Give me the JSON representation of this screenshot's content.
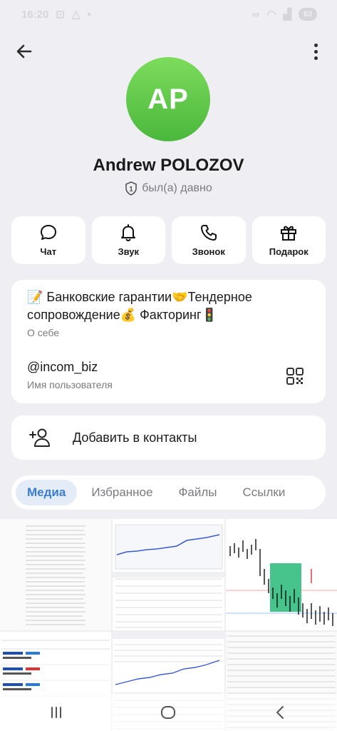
{
  "statusbar": {
    "time": "16:20",
    "battery": "83"
  },
  "profile": {
    "avatar_initials": "AP",
    "name": "Andrew POLOZOV",
    "last_seen": "был(а) давно",
    "avatar_color": "#5cc94a"
  },
  "actions": [
    {
      "label": "Чат",
      "icon": "chat-bubble-icon"
    },
    {
      "label": "Звук",
      "icon": "bell-icon"
    },
    {
      "label": "Звонок",
      "icon": "phone-icon"
    },
    {
      "label": "Подарок",
      "icon": "gift-icon"
    }
  ],
  "info": {
    "bio": "📝 Банковские гарантии🤝Тендерное сопровождение💰 Факторинг🚦",
    "bio_label": "О себе",
    "username": "@incom_biz",
    "username_label": "Имя пользователя"
  },
  "add_contact": {
    "label": "Добавить в контакты",
    "icon": "add-user-icon"
  },
  "tabs": [
    {
      "label": "Медиа",
      "active": true
    },
    {
      "label": "Избранное",
      "active": false
    },
    {
      "label": "Файлы",
      "active": false
    },
    {
      "label": "Ссылки",
      "active": false
    }
  ],
  "colors": {
    "accent": "#3a7cd0",
    "background": "#efeff3",
    "card": "#ffffff",
    "secondary_text": "#7a7a80"
  }
}
